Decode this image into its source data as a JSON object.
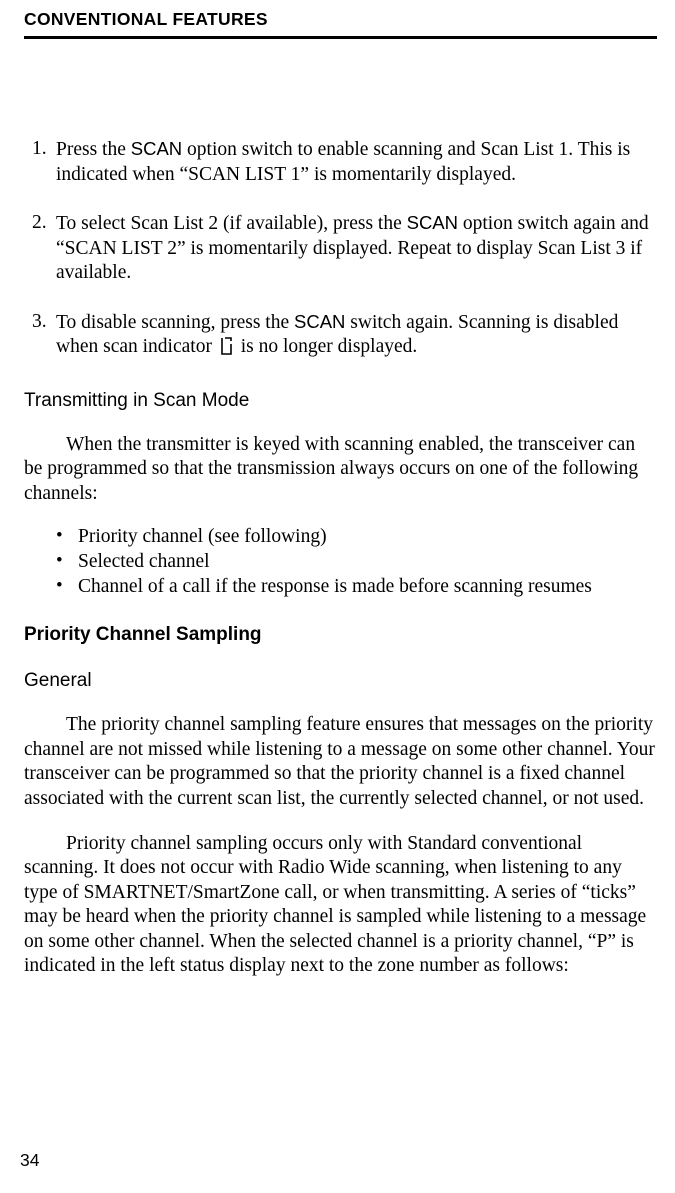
{
  "header": {
    "title": "CONVENTIONAL FEATURES"
  },
  "steps": [
    {
      "num": "1.",
      "pre": "Press the ",
      "kw": "SCAN",
      "post": " option switch to enable scanning and Scan List 1. This is indicated when “SCAN LIST 1” is momentarily displayed."
    },
    {
      "num": "2.",
      "pre": "To select Scan List 2 (if available), press the ",
      "kw": "SCAN",
      "post": " option switch again and “SCAN LIST 2” is momentarily displayed. Repeat to display Scan List 3 if available."
    },
    {
      "num": "3.",
      "pre": "To disable scanning, press the ",
      "kw": "SCAN",
      "post1": " switch again. Scanning is disabled when scan indicator ",
      "post2": " is no longer displayed."
    }
  ],
  "transmit": {
    "heading": "Transmitting in Scan Mode",
    "para": "When the transmitter is keyed with scanning enabled, the transceiver can be programmed so that the transmission always occurs on one of the following channels:",
    "bullets": [
      "Priority channel (see following)",
      "Selected channel",
      "Channel of a call if the response is made before scanning resumes"
    ]
  },
  "priority": {
    "heading": "Priority Channel Sampling",
    "sub": "General",
    "para1": "The priority channel sampling feature ensures that messages on the priority channel are not missed while listening to a message on some other channel. Your transceiver can be programmed so that the priority channel is a fixed channel associated with the current scan list, the currently selected channel, or not used.",
    "para2": "Priority channel sampling occurs only with Standard conventional scanning. It does not occur with Radio Wide scanning, when listening to any type of SMARTNET/SmartZone call, or when transmitting. A series of “ticks” may be heard when the priority channel is sampled while listening to a message on some other channel. When the selected channel is a priority channel, “P” is indicated in the left status display next to the zone number as follows:"
  },
  "page": {
    "num": "34"
  }
}
